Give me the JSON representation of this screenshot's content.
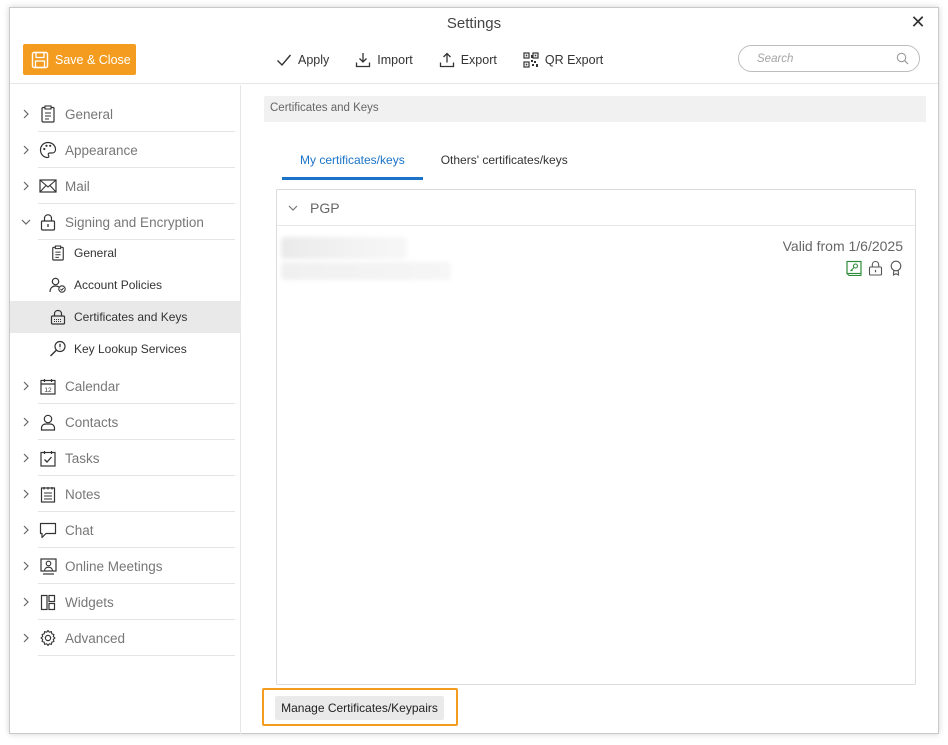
{
  "window": {
    "title": "Settings"
  },
  "toolbar": {
    "save_label": "Save & Close",
    "actions": [
      {
        "label": "Apply",
        "icon": "check-icon"
      },
      {
        "label": "Import",
        "icon": "import-icon"
      },
      {
        "label": "Export",
        "icon": "export-icon"
      },
      {
        "label": "QR Export",
        "icon": "qr-code-icon"
      }
    ],
    "search_placeholder": "Search"
  },
  "sidebar": {
    "items": [
      {
        "label": "General",
        "icon": "clipboard-icon"
      },
      {
        "label": "Appearance",
        "icon": "palette-icon"
      },
      {
        "label": "Mail",
        "icon": "envelope-icon"
      },
      {
        "label": "Signing and Encryption",
        "icon": "lock-icon",
        "expanded": true
      },
      {
        "label": "Calendar",
        "icon": "calendar-icon"
      },
      {
        "label": "Contacts",
        "icon": "person-icon"
      },
      {
        "label": "Tasks",
        "icon": "task-check-icon"
      },
      {
        "label": "Notes",
        "icon": "notes-icon"
      },
      {
        "label": "Chat",
        "icon": "chat-icon"
      },
      {
        "label": "Online Meetings",
        "icon": "meeting-icon"
      },
      {
        "label": "Widgets",
        "icon": "widgets-icon"
      },
      {
        "label": "Advanced",
        "icon": "gear-icon"
      }
    ],
    "subitems": [
      {
        "label": "General",
        "icon": "clipboard-icon"
      },
      {
        "label": "Account Policies",
        "icon": "account-policy-icon"
      },
      {
        "label": "Certificates and Keys",
        "icon": "certificate-lock-icon",
        "active": true
      },
      {
        "label": "Key Lookup Services",
        "icon": "key-lookup-icon"
      }
    ]
  },
  "content": {
    "breadcrumb": "Certificates and Keys",
    "tabs": [
      {
        "label": "My certificates/keys",
        "active": true
      },
      {
        "label": "Others' certificates/keys",
        "active": false
      }
    ],
    "section_label": "PGP",
    "key": {
      "valid_text": "Valid from 1/6/2025"
    },
    "manage_button": "Manage Certificates/Keypairs"
  },
  "colors": {
    "accent": "#f39c1f",
    "tab_active": "#1a73c8",
    "key_green": "#2e8b3a"
  }
}
